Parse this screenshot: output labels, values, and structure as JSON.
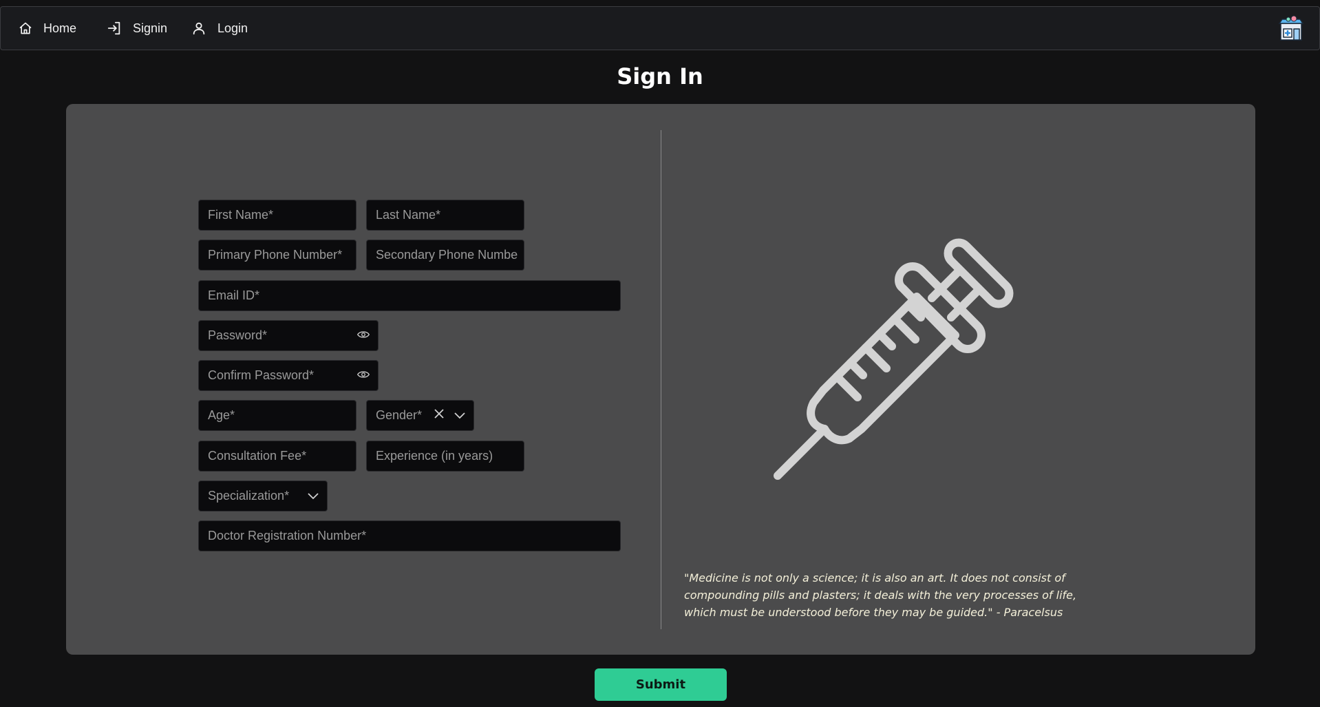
{
  "nav": {
    "items": [
      {
        "label": "Home",
        "icon": "home-icon"
      },
      {
        "label": "Signin",
        "icon": "sign-in-icon"
      },
      {
        "label": "Login",
        "icon": "user-icon"
      }
    ],
    "logo": "pharmacy-store-icon"
  },
  "page": {
    "title": "Sign In"
  },
  "form": {
    "first_name": "First Name*",
    "last_name": "Last Name*",
    "primary_phone": "Primary Phone Number*",
    "secondary_phone": "Secondary Phone Numbe",
    "email": "Email ID*",
    "password": "Password*",
    "confirm_password": "Confirm Password*",
    "age": "Age*",
    "gender": "Gender*",
    "consultation_fee": "Consultation Fee*",
    "experience": "Experience (in years)",
    "specialization": "Specialization*",
    "registration_number": "Doctor Registration Number*"
  },
  "aside": {
    "illustration": "syringe-icon",
    "quote": "\"Medicine is not only a science; it is also an art. It does not consist of compounding pills and plasters; it deals with the very processes of life, which must be understood before they may be guided.\" - Paracelsus"
  },
  "submit_label": "Submit",
  "colors": {
    "background": "#121213",
    "card": "#4b4b4c",
    "field": "#0b0b0d",
    "accent": "#2fcc94",
    "quote_text": "#f4f0d9"
  }
}
